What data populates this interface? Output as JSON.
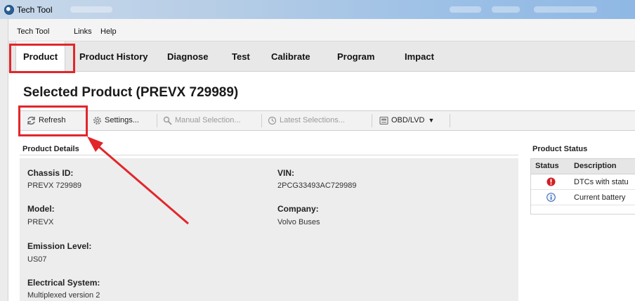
{
  "window": {
    "title": "Tech Tool"
  },
  "menubar": {
    "items": [
      "Tech Tool",
      "Links",
      "Help"
    ]
  },
  "tabs": [
    "Product",
    "Product History",
    "Diagnose",
    "Test",
    "Calibrate",
    "Program",
    "Impact"
  ],
  "active_tab": "Product",
  "page": {
    "title": "Selected Product (PREVX 729989)"
  },
  "toolbar": {
    "refresh": "Refresh",
    "settings": "Settings...",
    "manual_selection": "Manual Selection...",
    "latest_selections": "Latest Selections...",
    "obd": "OBD/LVD"
  },
  "product_details": {
    "heading": "Product Details",
    "chassis_label": "Chassis ID:",
    "chassis_value": "PREVX 729989",
    "vin_label": "VIN:",
    "vin_value": "2PCG33493AC729989",
    "model_label": "Model:",
    "model_value": "PREVX",
    "company_label": "Company:",
    "company_value": "Volvo Buses",
    "emission_label": "Emission Level:",
    "emission_value": "US07",
    "electrical_label": "Electrical System:",
    "electrical_value": "Multiplexed version 2"
  },
  "product_status": {
    "heading": "Product Status",
    "col_status": "Status",
    "col_description": "Description",
    "rows": [
      {
        "icon": "error-icon",
        "description": "DTCs with statu"
      },
      {
        "icon": "info-icon",
        "description": "Current battery"
      }
    ]
  },
  "colors": {
    "highlight": "#e2262b",
    "error": "#d11f24",
    "info": "#2c5fb4"
  }
}
